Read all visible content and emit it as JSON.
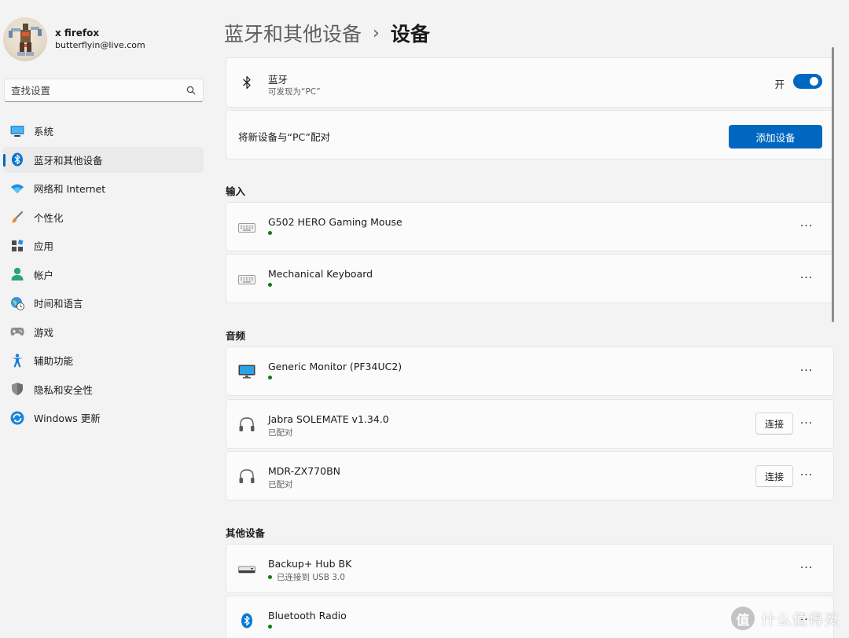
{
  "profile": {
    "name": "x firefox",
    "email": "butterflyin@live.com"
  },
  "search": {
    "placeholder": "查找设置",
    "icon": "search-icon"
  },
  "sidebar": {
    "items": [
      {
        "label": "系统",
        "icon": "system-icon"
      },
      {
        "label": "蓝牙和其他设备",
        "icon": "bluetooth-icon",
        "active": true
      },
      {
        "label": "网络和 Internet",
        "icon": "wifi-icon"
      },
      {
        "label": "个性化",
        "icon": "brush-icon"
      },
      {
        "label": "应用",
        "icon": "apps-icon"
      },
      {
        "label": "帐户",
        "icon": "account-icon"
      },
      {
        "label": "时间和语言",
        "icon": "time-language-icon"
      },
      {
        "label": "游戏",
        "icon": "gamepad-icon"
      },
      {
        "label": "辅助功能",
        "icon": "accessibility-icon"
      },
      {
        "label": "隐私和安全性",
        "icon": "shield-icon"
      },
      {
        "label": "Windows 更新",
        "icon": "update-icon"
      }
    ]
  },
  "breadcrumb": {
    "parent": "蓝牙和其他设备",
    "separator": "›",
    "current": "设备"
  },
  "bluetooth": {
    "title": "蓝牙",
    "subtitle": "可发现为“PC”",
    "toggle_label": "开",
    "on": true
  },
  "pair": {
    "label": "将新设备与“PC”配对",
    "button": "添加设备"
  },
  "sections": {
    "input": "输入",
    "audio": "音频",
    "other": "其他设备"
  },
  "devices": {
    "input": [
      {
        "name": "G502 HERO Gaming Mouse",
        "icon": "keyboard-icon",
        "connected": true
      },
      {
        "name": "Mechanical Keyboard",
        "icon": "keyboard-icon",
        "connected": true
      }
    ],
    "audio": [
      {
        "name": "Generic Monitor (PF34UC2)",
        "icon": "monitor-icon",
        "connected": true
      },
      {
        "name": "Jabra SOLEMATE v1.34.0",
        "icon": "headphones-icon",
        "status": "已配对",
        "button": "连接"
      },
      {
        "name": "MDR-ZX770BN",
        "icon": "headphones-icon",
        "status": "已配对",
        "button": "连接"
      }
    ],
    "other": [
      {
        "name": "Backup+ Hub BK",
        "icon": "drive-icon",
        "status": "已连接到 USB 3.0",
        "connected": true
      },
      {
        "name": "Bluetooth Radio",
        "icon": "bluetooth-icon",
        "connected": true
      }
    ]
  },
  "more_glyph": "···",
  "watermark": {
    "logo": "值",
    "text": "什么值得买"
  },
  "colors": {
    "accent": "#0067c0",
    "connected_dot": "#0f7b0f",
    "background": "#f3f3f3",
    "card": "#fbfbfb"
  }
}
